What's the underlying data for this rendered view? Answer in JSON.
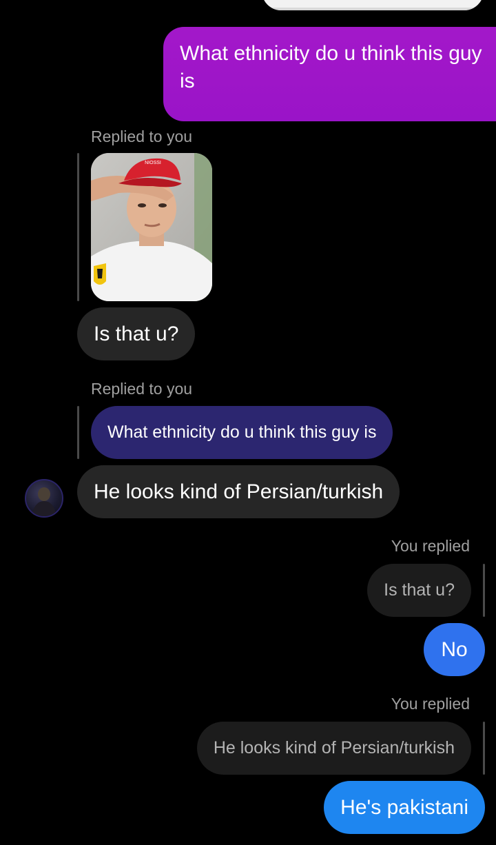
{
  "chat": {
    "messages": [
      {
        "id": "m1",
        "sender": "me",
        "text": "What ethnicity do u think this guy is"
      },
      {
        "id": "m2",
        "sender": "them",
        "reply_label": "Replied to you",
        "text": "Is that u?"
      },
      {
        "id": "m3",
        "sender": "them",
        "reply_label": "Replied to you",
        "quoted_text": "What ethnicity do u think this guy is",
        "text": "He looks kind of Persian/turkish"
      },
      {
        "id": "m4",
        "sender": "me",
        "reply_label": "You replied",
        "quoted_text": "Is that u?",
        "text": "No"
      },
      {
        "id": "m5",
        "sender": "me",
        "reply_label": "You replied",
        "quoted_text": "He looks kind of Persian/turkish",
        "text": "He's pakistani"
      }
    ]
  },
  "photo": {
    "cap_text": "NIOSSI"
  },
  "colors": {
    "background": "#000000",
    "outgoing_purple": "#a318c9",
    "quoted_purple": "#2c2670",
    "incoming_gray": "#262626",
    "quoted_gray": "#1c1c1c",
    "outgoing_blue_1": "#2f72ee",
    "outgoing_blue_2": "#1e86f0",
    "secondary_text": "#a0a0a0"
  }
}
